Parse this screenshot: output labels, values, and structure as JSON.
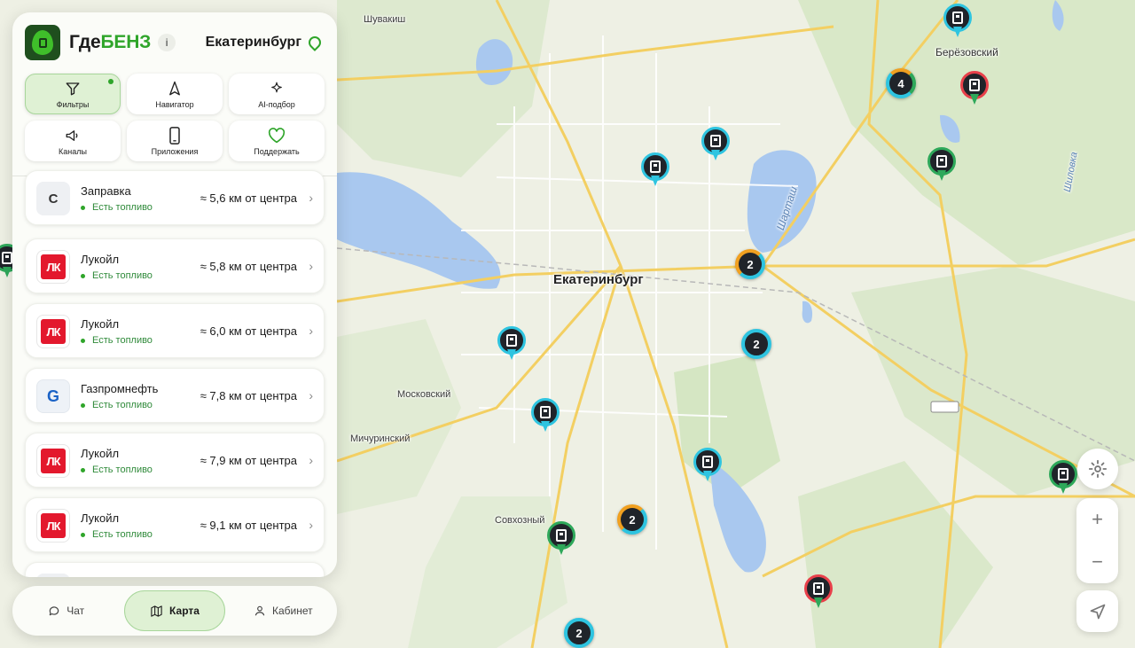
{
  "brand": {
    "prefix": "Где",
    "accent": "БЕНЗ"
  },
  "info_label": "i",
  "city": "Екатеринбург",
  "tiles": [
    {
      "label": "Фильтры",
      "icon": "filter-icon",
      "active": true
    },
    {
      "label": "Навигатор",
      "icon": "navigation-arrow-icon"
    },
    {
      "label": "AI-подбор",
      "icon": "sparkle-icon"
    },
    {
      "label": "Каналы",
      "icon": "megaphone-icon"
    },
    {
      "label": "Приложения",
      "icon": "phone-icon"
    },
    {
      "label": "Поддержать",
      "icon": "heart-icon"
    }
  ],
  "stations": [
    {
      "logo": "С",
      "brand_type": "generic",
      "name": "Заправка",
      "status": "Есть топливо",
      "distance": "≈ 5,6 км от центра"
    },
    {
      "logo": "ЛК",
      "brand_type": "lukoil",
      "name": "Лукойл",
      "status": "Есть топливо",
      "distance": "≈ 5,8 км от центра"
    },
    {
      "logo": "ЛК",
      "brand_type": "lukoil",
      "name": "Лукойл",
      "status": "Есть топливо",
      "distance": "≈ 6,0 км от центра"
    },
    {
      "logo": "G",
      "brand_type": "gazpromneft",
      "name": "Газпромнефть",
      "status": "Есть топливо",
      "distance": "≈ 7,8 км от центра"
    },
    {
      "logo": "ЛК",
      "brand_type": "lukoil",
      "name": "Лукойл",
      "status": "Есть топливо",
      "distance": "≈ 7,9 км от центра"
    },
    {
      "logo": "ЛК",
      "brand_type": "lukoil",
      "name": "Лукойл",
      "status": "Есть топливо",
      "distance": "≈ 9,1 км от центра"
    }
  ],
  "nav": [
    {
      "label": "Чат",
      "icon": "chat-icon"
    },
    {
      "label": "Карта",
      "icon": "map-icon",
      "active": true
    },
    {
      "label": "Кабинет",
      "icon": "user-icon"
    }
  ],
  "map": {
    "labels": {
      "city": "Екатеринбург",
      "shuvakish": "Шувакиш",
      "berezovsky": "Берёзовский",
      "moskovsky": "Московский",
      "michurinsky": "Мичуринский",
      "sovkhozny": "Совхозный",
      "shartash": "Шарташ",
      "shilovka": "Шиловка"
    },
    "clusters": [
      "4",
      "2",
      "2",
      "2",
      "2"
    ],
    "controls": {
      "zoom_in": "+",
      "zoom_out": "−"
    }
  },
  "colors": {
    "accent": "#2fa52a",
    "pin_cyan": "#2ec4e0",
    "pin_green": "#2ea85a",
    "pin_red": "#e8404a",
    "cluster_orange": "#f0a020"
  }
}
